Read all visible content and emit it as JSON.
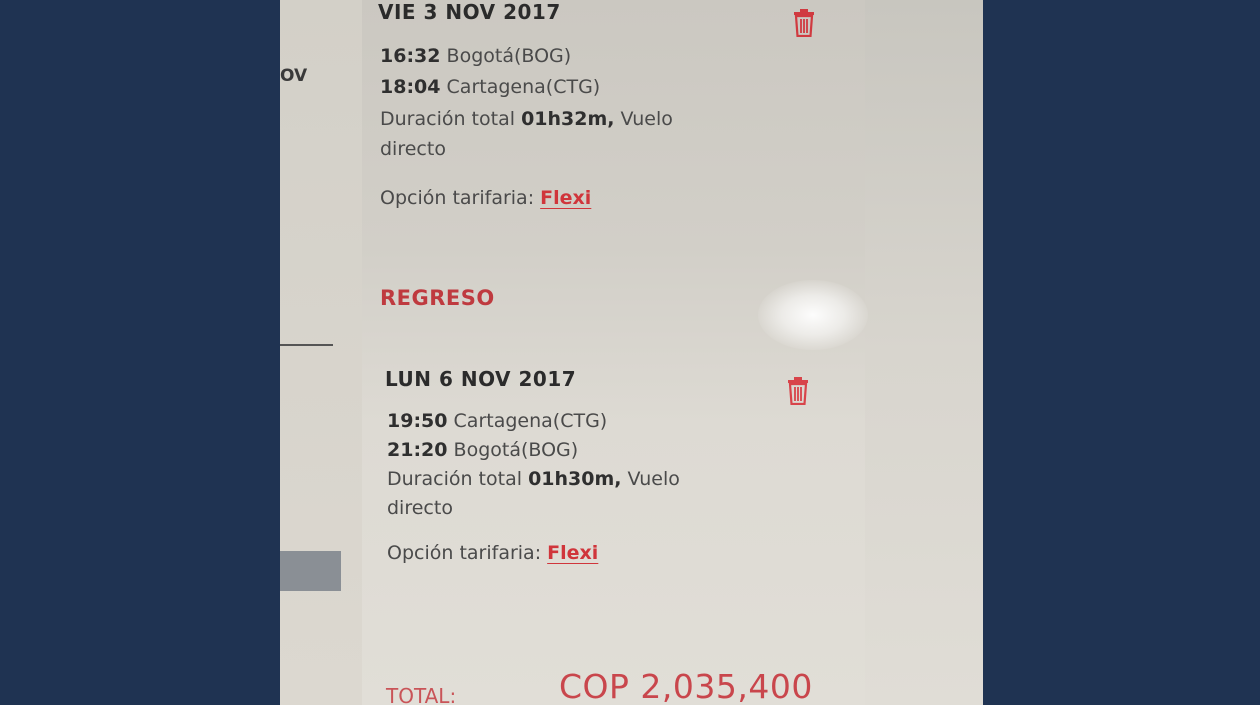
{
  "left_fragment": "OV",
  "ida": {
    "date": "VIE 3 NOV 2017",
    "dep_time": "16:32",
    "dep_place": "Bogotá(BOG)",
    "arr_time": "18:04",
    "arr_place": "Cartagena(CTG)",
    "duration_prefix": "Duración total",
    "duration": "01h32m,",
    "duration_suffix": "Vuelo",
    "duration_line2": "directo",
    "fare_label": "Opción tarifaria:",
    "fare_value": "Flexi"
  },
  "regreso": {
    "title": "REGRESO",
    "date": "LUN 6 NOV 2017",
    "dep_time": "19:50",
    "dep_place": "Cartagena(CTG)",
    "arr_time": "21:20",
    "arr_place": "Bogotá(BOG)",
    "duration_prefix": "Duración total",
    "duration": "01h30m,",
    "duration_suffix": "Vuelo",
    "duration_line2": "directo",
    "fare_label": "Opción tarifaria:",
    "fare_value": "Flexi"
  },
  "total": {
    "label": "TOTAL:",
    "currency": "COP",
    "amount": "2,035,400"
  },
  "icons": [
    "trash-icon",
    "trash-icon"
  ],
  "colors": {
    "accent_red": "#c9353c",
    "background_navy": "#1f3352"
  }
}
